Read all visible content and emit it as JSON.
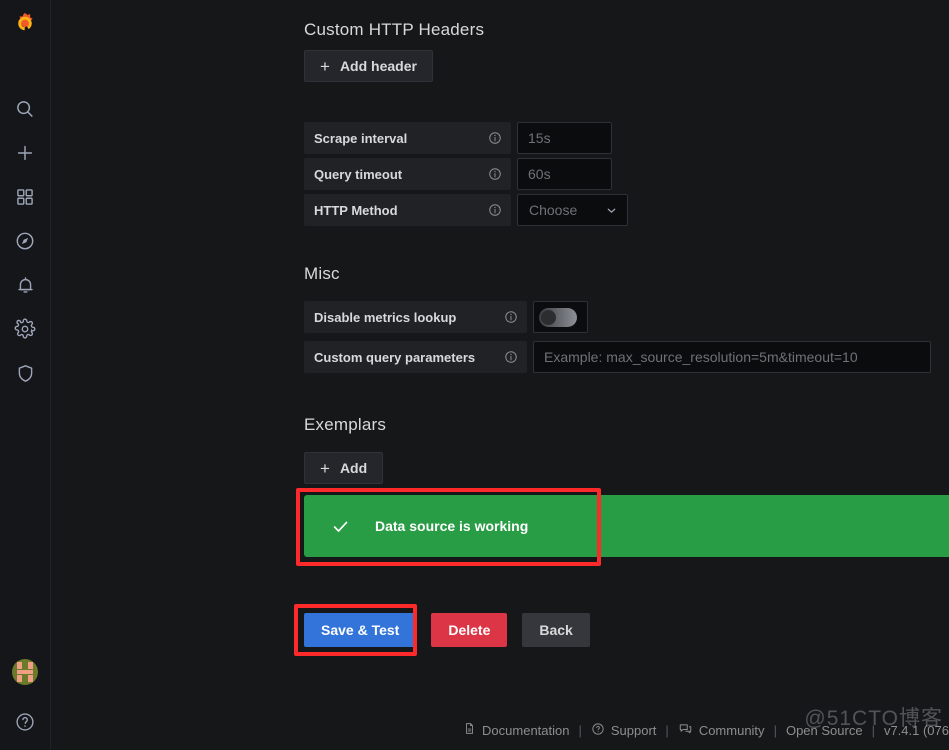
{
  "sidebar": {
    "brand_icon": "grafana-logo",
    "items": [
      {
        "icon": "search-icon",
        "name": "search"
      },
      {
        "icon": "plus-icon",
        "name": "create"
      },
      {
        "icon": "dashboards-icon",
        "name": "dashboards"
      },
      {
        "icon": "compass-icon",
        "name": "explore"
      },
      {
        "icon": "bell-icon",
        "name": "alerting"
      },
      {
        "icon": "gear-icon",
        "name": "configuration"
      },
      {
        "icon": "shield-icon",
        "name": "server-admin"
      }
    ],
    "avatar_name": "user-avatar",
    "help_icon": "help-circle-icon"
  },
  "sections": {
    "custom_headers": {
      "title": "Custom HTTP Headers",
      "add_header_label": "Add header",
      "plus": "+"
    },
    "http_settings": {
      "rows": [
        {
          "label": "Scrape interval",
          "placeholder": "15s",
          "value": "",
          "info": "info-circle-icon"
        },
        {
          "label": "Query timeout",
          "placeholder": "60s",
          "value": "",
          "info": "info-circle-icon"
        }
      ],
      "http_method": {
        "label": "HTTP Method",
        "selected": "Choose",
        "info": "info-circle-icon"
      }
    },
    "misc": {
      "title": "Misc",
      "disable_metrics_lookup": {
        "label": "Disable metrics lookup",
        "toggle_state": "off",
        "info": "info-circle-icon"
      },
      "custom_query_parameters": {
        "label": "Custom query parameters",
        "placeholder": "Example: max_source_resolution=5m&timeout=10",
        "value": "",
        "info": "info-circle-icon"
      }
    },
    "exemplars": {
      "title": "Exemplars",
      "add_label": "Add",
      "plus": "+"
    }
  },
  "alert": {
    "message": "Data source is working",
    "icon": "check-icon",
    "color": "#299c46"
  },
  "actions": {
    "save_and_test": "Save & Test",
    "delete": "Delete",
    "back": "Back",
    "primary_color": "#3274d9",
    "danger_color": "#dc3545"
  },
  "annotations": {
    "color": "#fc2a2a",
    "boxes": [
      "alert-highlight",
      "save-and-test-highlight"
    ]
  },
  "footer": {
    "documentation": "Documentation",
    "support": "Support",
    "community": "Community",
    "open_source": "Open Source",
    "separator": "|",
    "version": "v7.4.1 (076"
  },
  "watermark": "@51CTO博客"
}
